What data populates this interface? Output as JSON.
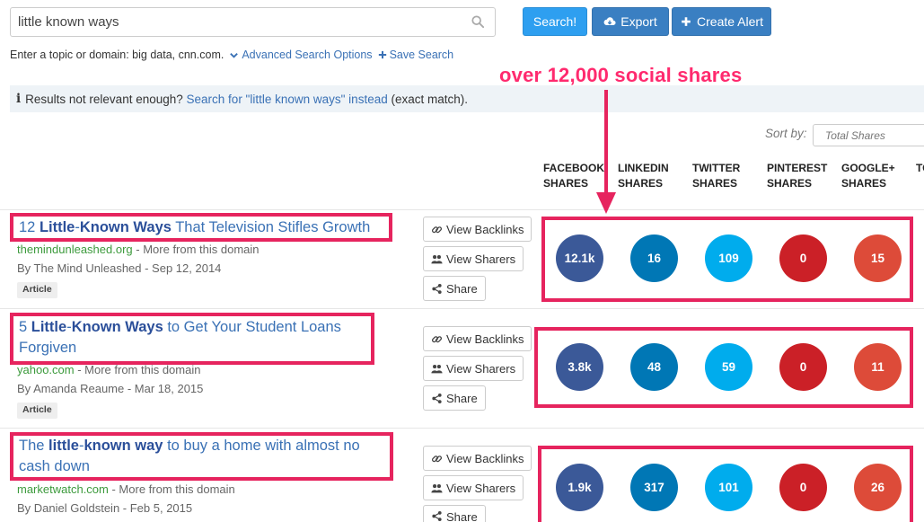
{
  "search": {
    "value": "little known ways",
    "placeholder": ""
  },
  "buttons": {
    "search": "Search!",
    "export": "Export",
    "create_alert": "Create Alert"
  },
  "hint": {
    "text": "Enter a topic or domain: big data, cnn.com.",
    "advanced": "Advanced Search Options",
    "save": "Save Search"
  },
  "notice": {
    "prefix": "Results not relevant enough?",
    "link": "Search for \"little known ways\" instead",
    "suffix": "(exact match)."
  },
  "sort": {
    "label": "Sort by:",
    "value": "Total Shares"
  },
  "columns": {
    "facebook": "FACEBOOK\nSHARES",
    "linkedin": "LINKEDIN\nSHARES",
    "twitter": "TWITTER\nSHARES",
    "pinterest": "PINTEREST\nSHARES",
    "googleplus": "GOOGLE+\nSHARES",
    "total": "TO"
  },
  "annotation": "over 12,000 social shares",
  "actions": {
    "backlinks": "View Backlinks",
    "sharers": "View Sharers",
    "share": "Share"
  },
  "colors": {
    "facebook": "#3b5998",
    "linkedin": "#0077b5",
    "twitter": "#00aced",
    "pinterest": "#cb2027",
    "googleplus": "#dd4b39",
    "highlight": "#e6245e"
  },
  "results": [
    {
      "title_pre": "12 ",
      "title_b1": "Little",
      "title_mid": "-",
      "title_b2": "Known Ways",
      "title_post": " That Television Stifles Growth",
      "domain": "themindunleashed.org",
      "more": " - More from this domain",
      "author": "By The Mind Unleashed - Sep 12, 2014",
      "badge": "Article",
      "shares": {
        "facebook": "12.1k",
        "linkedin": "16",
        "twitter": "109",
        "pinterest": "0",
        "googleplus": "15"
      }
    },
    {
      "title_pre": "5 ",
      "title_b1": "Little",
      "title_mid": "-",
      "title_b2": "Known Ways",
      "title_post": " to Get Your Student Loans Forgiven",
      "domain": "yahoo.com",
      "more": " - More from this domain",
      "author": "By Amanda Reaume - Mar 18, 2015",
      "badge": "Article",
      "shares": {
        "facebook": "3.8k",
        "linkedin": "48",
        "twitter": "59",
        "pinterest": "0",
        "googleplus": "11"
      }
    },
    {
      "title_pre": "The ",
      "title_b1": "little",
      "title_mid": "-",
      "title_b2": "known way",
      "title_post": " to buy a home with almost no cash down",
      "domain": "marketwatch.com",
      "more": " - More from this domain",
      "author": "By Daniel Goldstein - Feb 5, 2015",
      "badge": "",
      "shares": {
        "facebook": "1.9k",
        "linkedin": "317",
        "twitter": "101",
        "pinterest": "0",
        "googleplus": "26"
      }
    }
  ]
}
